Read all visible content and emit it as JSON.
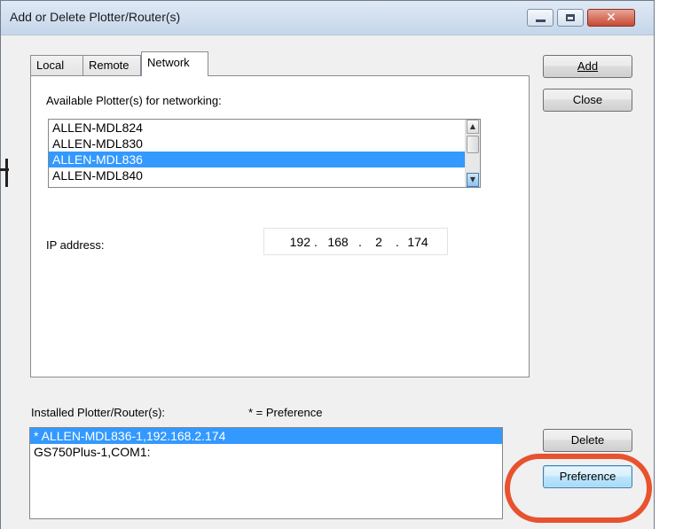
{
  "window": {
    "title": "Add or Delete Plotter/Router(s)"
  },
  "tabs": [
    {
      "label": "Local",
      "active": false
    },
    {
      "label": "Remote",
      "active": false
    },
    {
      "label": "Network",
      "active": true
    }
  ],
  "network": {
    "available_label": "Available Plotter(s) for networking:",
    "available_items": [
      "ALLEN-MDL824",
      "ALLEN-MDL830",
      "ALLEN-MDL836",
      "ALLEN-MDL840"
    ],
    "selected_item": "ALLEN-MDL836",
    "ip_label": "IP address:",
    "ip_parts": [
      "192",
      "168",
      "2",
      "174"
    ]
  },
  "installed": {
    "label": "Installed Plotter/Router(s):",
    "preference_note": "* = Preference",
    "items": [
      "* ALLEN-MDL836-1,192.168.2.174",
      "GS750Plus-1,COM1:"
    ],
    "selected_item": "* ALLEN-MDL836-1,192.168.2.174"
  },
  "buttons": {
    "add": "Add",
    "close": "Close",
    "delete": "Delete",
    "preference": "Preference"
  },
  "icons": {
    "minimize": "minimize-icon",
    "maximize": "maximize-icon",
    "close": "close-icon",
    "scroll_up": "scroll-up-arrow-icon",
    "scroll_down": "scroll-down-arrow-icon"
  },
  "colors": {
    "selection": "#3399ff",
    "highlight_annotation": "#e8522f",
    "close_button": "#c64b34"
  }
}
